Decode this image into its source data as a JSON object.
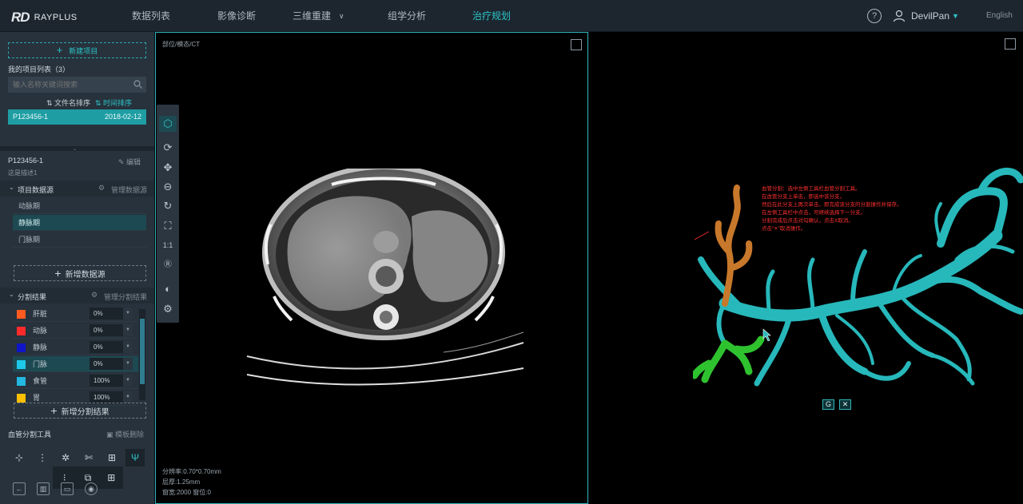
{
  "header": {
    "logo_mark": "RD",
    "logo_text": "RAYPLUS",
    "nav": [
      "数据列表",
      "影像诊断",
      "三维重建",
      "组学分析",
      "治疗规划"
    ],
    "active_nav": "治疗规划",
    "help": "?",
    "username": "DevilPan",
    "language": "English"
  },
  "sidebar": {
    "new_project": "新建项目",
    "my_projects": "我的项目列表（3）",
    "search_placeholder": "输入名称关键词搜索",
    "sort_filename": "文件名排序",
    "sort_time": "时间排序",
    "projects": [
      {
        "name": "P123456-1",
        "date": "2018-02-12"
      }
    ],
    "project_title": "P123456-1",
    "edit": "编辑",
    "description": "这是描述1",
    "datasource_title": "项目数据源",
    "manage_datasource": "管理数据源",
    "datasources": [
      "动脉期",
      "静脉期",
      "门脉期"
    ],
    "selected_datasource": "静脉期",
    "add_datasource": "新增数据源",
    "seg_title": "分割结果",
    "manage_seg": "管理分割结果",
    "segments": [
      {
        "name": "肝脏",
        "color": "#ff5a1f",
        "value": "0%"
      },
      {
        "name": "动脉",
        "color": "#ff2a2a",
        "value": "0%"
      },
      {
        "name": "静脉",
        "color": "#1015c8",
        "value": "0%"
      },
      {
        "name": "门脉",
        "color": "#1ec8e8",
        "value": "0%"
      },
      {
        "name": "食管",
        "color": "#22b8e0",
        "value": "100%"
      },
      {
        "name": "胃",
        "color": "#ffbf00",
        "value": "100%"
      }
    ],
    "selected_segment": "门脉",
    "add_seg": "新增分割结果",
    "vessel_tools": "血管分割工具",
    "template_delete": "模板删除"
  },
  "viewport_left": {
    "label": "部位/模态/CT",
    "info_line1": "分辨率:0.70*0.70mm",
    "info_line2": "层厚:1.25mm",
    "info_line3": "窗宽:2000 窗位:0"
  },
  "viewport_right": {
    "annotation": [
      "血管分割：选中左侧工具栏血管分割工具。",
      "在血管分支上单击，即选中该分支。",
      "然后在此分支上再次单击，即完成该分支的分割操作并保存。",
      "在左侧工具栏中点击，可继续选择下一分支。",
      "分割完成后点击对勾确认，点击X取消。",
      "点击“✕”取消操作。"
    ],
    "confirm": "G",
    "cancel": "✕"
  },
  "colors": {
    "accent": "#2cc4c8",
    "vessel": "#27b8bb",
    "branch_orange": "#c8782a",
    "branch_green": "#2fc22f"
  }
}
